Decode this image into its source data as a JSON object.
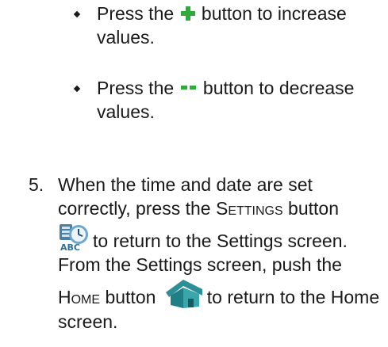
{
  "bullets": [
    {
      "before": "Press the",
      "icon": "plus-icon",
      "after": " button to increase values."
    },
    {
      "before": "Press the",
      "icon": "minus-icon",
      "after": " button to decrease values."
    }
  ],
  "step5": {
    "number": "5.",
    "line1": "When the time and date are set correctly, press the",
    "settings_label": "Settings",
    "line1_end": " button",
    "after_settings_icon": "to return to the Settings screen. From the Settings screen, push the",
    "home_label": "Home",
    "home_button_word": " button",
    "after_home_icon": "to return to the Home screen.",
    "settings_icon_text": "ABC",
    "settings_icon": "settings-icon",
    "home_icon": "home-icon"
  },
  "colors": {
    "accent_green": "#2faa3b",
    "house_teal": "#1f7f86"
  }
}
